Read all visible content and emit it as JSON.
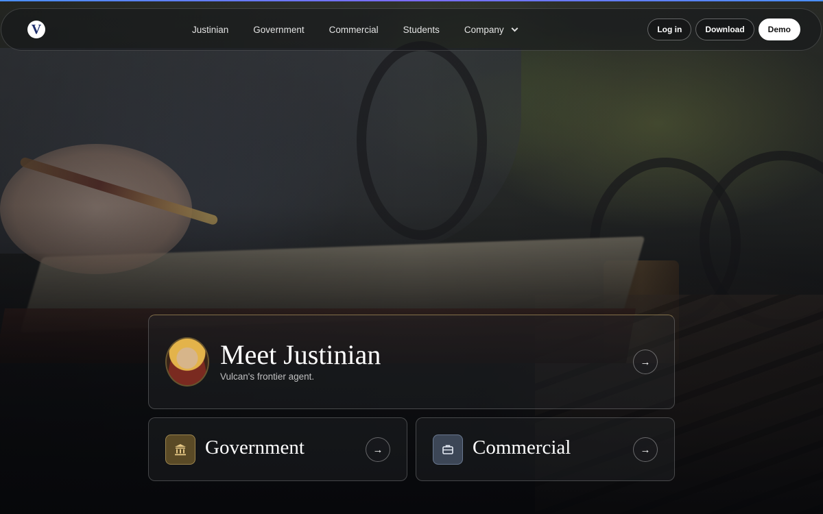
{
  "nav": {
    "logo_letter": "V",
    "links": [
      "Justinian",
      "Government",
      "Commercial",
      "Students",
      "Company"
    ],
    "login_label": "Log in",
    "download_label": "Download",
    "demo_label": "Demo"
  },
  "hero": {
    "main_card": {
      "title": "Meet Justinian",
      "subtitle": "Vulcan's frontier agent."
    },
    "gov_card": {
      "title": "Government"
    },
    "com_card": {
      "title": "Commercial"
    },
    "arrow_glyph": "→"
  },
  "colors": {
    "accent_top": "#4a90ff",
    "gov_tile": "#5a4a26",
    "com_tile": "#3c4656",
    "logo_letter": "#1e2f6e"
  },
  "icons": {
    "main_avatar": "emperor-mosaic-avatar",
    "gov": "bank-building-icon",
    "com": "briefcase-icon",
    "company_dropdown": "chevron-down-icon"
  }
}
